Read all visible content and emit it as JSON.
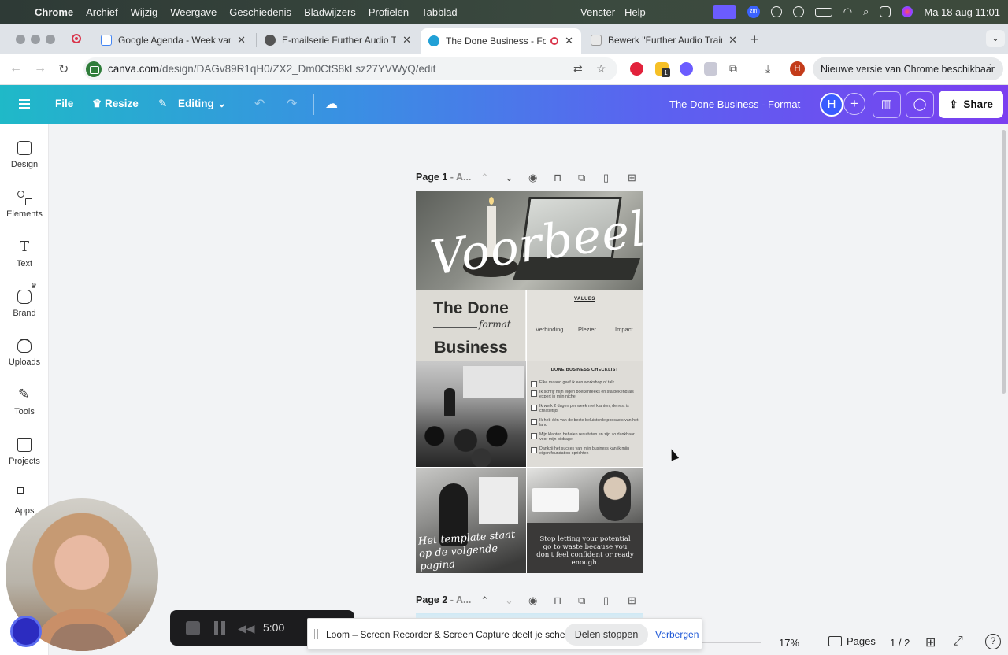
{
  "menubar": {
    "app_name": "Chrome",
    "items": [
      "Archief",
      "Wijzig",
      "Weergave",
      "Geschiedenis",
      "Bladwijzers",
      "Profielen",
      "Tabblad"
    ],
    "right_items": [
      "Venster",
      "Help"
    ],
    "zoom_label": "zm",
    "datetime": "Ma 18 aug  11:01"
  },
  "tabs": [
    {
      "title": "Google Agenda - Week van 1"
    },
    {
      "title": "E-mailserie Further Audio Tra"
    },
    {
      "title": "The Done Business - Form"
    },
    {
      "title": "Bewerk \"Further Audio Trainin"
    }
  ],
  "address": {
    "domain": "canva.com",
    "path": "/design/DAGv89R1qH0/ZX2_Dm0CtS8kLsz27YVWyQ/edit",
    "avatar_letter": "H",
    "ext_badge": "1",
    "update_text": "Nieuwe versie van Chrome beschikbaar"
  },
  "canva_header": {
    "file": "File",
    "resize": "Resize",
    "editing": "Editing",
    "title": "The Done Business - Format",
    "avatar_letter": "H",
    "share": "Share"
  },
  "sidebar": {
    "items": [
      {
        "label": "Design"
      },
      {
        "label": "Elements"
      },
      {
        "label": "Text"
      },
      {
        "label": "Brand"
      },
      {
        "label": "Uploads"
      },
      {
        "label": "Tools"
      },
      {
        "label": "Projects"
      },
      {
        "label": "Apps"
      }
    ]
  },
  "page1": {
    "label": "Page 1",
    "label_suffix": " - A..."
  },
  "page2": {
    "label": "Page 2",
    "label_suffix": " - A..."
  },
  "design": {
    "hero_script": "Voorbeeld",
    "brand_line1": "The Done",
    "brand_script": "format",
    "brand_line2": "Business",
    "values_heading": "VALUES",
    "values": [
      "Verbinding",
      "Plezier",
      "Impact"
    ],
    "checklist_heading": "DONE BUSINESS CHECKLIST",
    "checklist": [
      "Elke maand geef ik een workshop of talk",
      "Ik schrijf mijn eigen boekenreeks en sta bekend als expert in mijn niche",
      "Ik werk 2 dagen per week met klanten, de rest is creatietijd",
      "Ik heb één van de beste beluisterde podcasts van het land",
      "Mijn klanten behalen resultaten en zijn zo dankbaar voor mijn bijdrage",
      "Dankzij het succes van mijn business kan ik mijn eigen foundation oprichten"
    ],
    "template_script": "Het template staat op de volgende pagina",
    "quote": "Stop letting your potential go to waste because you don't feel confident or ready enough."
  },
  "bottom": {
    "zoom": "17%",
    "pages": "Pages",
    "page_count": "1 / 2",
    "help": "?"
  },
  "loom": {
    "time": "5:00",
    "banner_text": "Loom – Screen Recorder & Screen Capture deelt je scherm.",
    "stop_label": "Delen stoppen",
    "hide_label": "Verbergen"
  }
}
